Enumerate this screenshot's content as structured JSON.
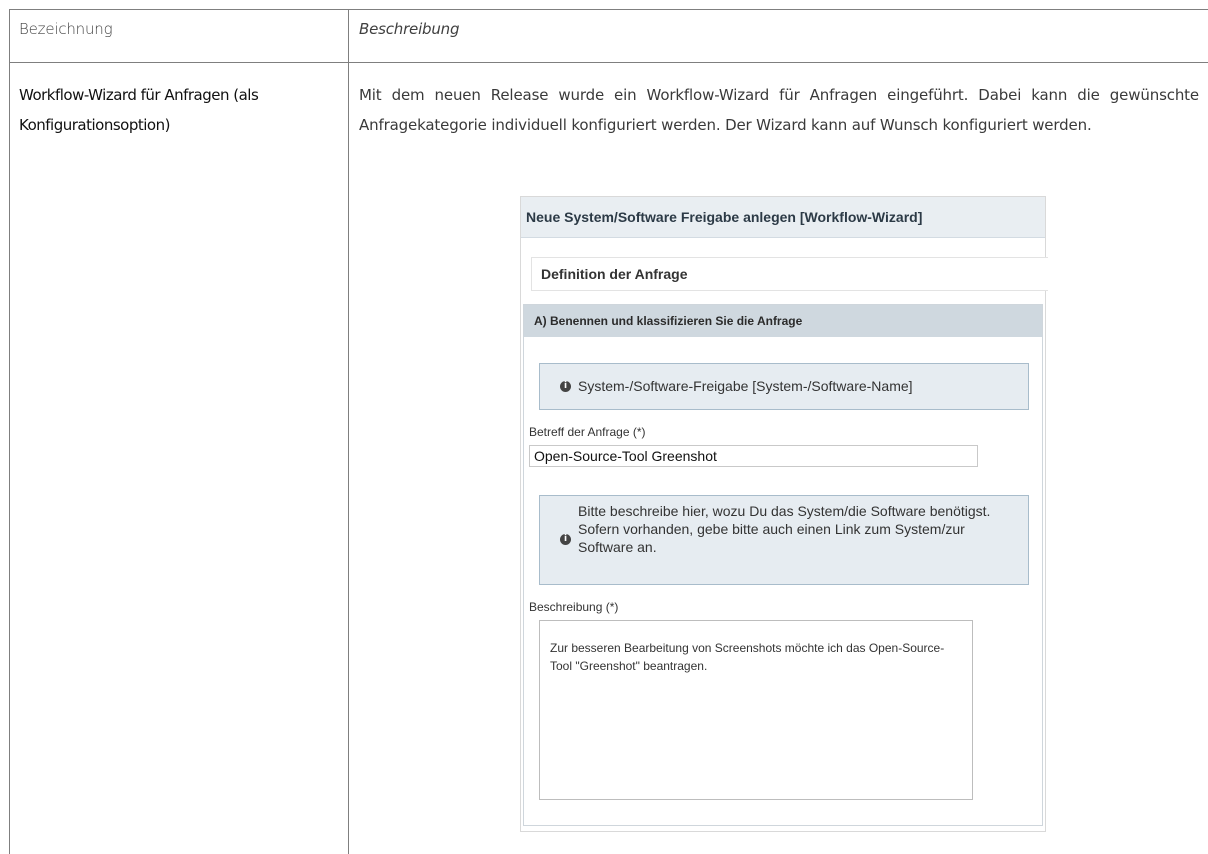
{
  "table": {
    "header": {
      "term": "Bezeichnung",
      "description": "Beschreibung"
    },
    "row": {
      "term_line1": "Workflow-Wizard für Anfragen (als",
      "term_line2": "Konfigurationsoption)",
      "description": "Mit dem neuen Release wurde ein Workflow-Wizard für Anfragen eingeführt. Dabei kann die gewünschte Anfragekategorie individuell konfiguriert werden. Der Wizard kann auf Wunsch konfiguriert werden."
    }
  },
  "screenshot": {
    "title": "Neue System/Software Freigabe anlegen [Workflow-Wizard]",
    "section_title": "Definition der Anfrage",
    "panel_title": "A) Benennen und klassifizieren Sie die Anfrage",
    "info1": "System-/Software-Freigabe [System-/Software-Name]",
    "subject_label": "Betreff der Anfrage (*)",
    "subject_value": "Open-Source-Tool Greenshot",
    "info2": "Bitte beschreibe hier, wozu Du das System/die Software benötigst. Sofern vorhanden, gebe bitte auch einen Link zum System/zur Software an.",
    "description_label": "Beschreibung (*)",
    "description_value": "Zur besseren Bearbeitung von Screenshots möchte ich das Open-Source-Tool \"Greenshot\" beantragen.",
    "info_icon": "info-icon"
  },
  "colors": {
    "table_border": "#7f7f7f",
    "title_bar": "#e9eef2",
    "panel_header": "#cfd8df",
    "info_box": "#e6ecf1",
    "info_border": "#a8bccb"
  }
}
